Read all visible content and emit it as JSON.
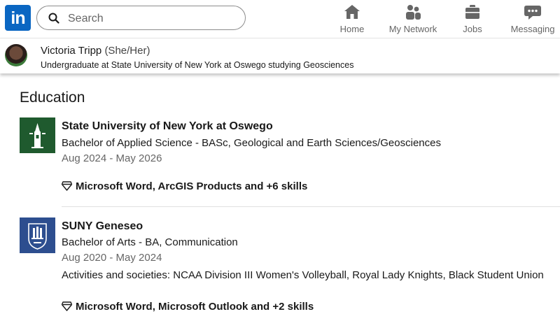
{
  "nav": {
    "logo_text": "in",
    "search": {
      "placeholder": "Search",
      "value": ""
    },
    "items": [
      {
        "label": "Home",
        "icon": "home-icon"
      },
      {
        "label": "My Network",
        "icon": "network-icon"
      },
      {
        "label": "Jobs",
        "icon": "briefcase-icon"
      },
      {
        "label": "Messaging",
        "icon": "messaging-icon"
      }
    ]
  },
  "profile": {
    "name": "Victoria Tripp",
    "pronouns": "(She/Her)",
    "headline": "Undergraduate at State University of New York at Oswego studying Geosciences"
  },
  "education": {
    "title": "Education",
    "entries": [
      {
        "school": "State University of New York at Oswego",
        "degree": "Bachelor of Applied Science - BASc, Geological and Earth Sciences/Geosciences",
        "dates": "Aug 2024 - May 2026",
        "skills": "Microsoft Word, ArcGIS Products and +6 skills",
        "logo_color": "#1f5a2e"
      },
      {
        "school": "SUNY Geneseo",
        "degree": "Bachelor of Arts - BA, Communication",
        "dates": "Aug 2020 - May 2024",
        "activities": "Activities and societies: NCAA Division III Women's Volleyball, Royal Lady Knights, Black Student Union",
        "skills": "Microsoft Word, Microsoft Outlook and +2 skills",
        "logo_color": "#2d4e8f"
      }
    ]
  },
  "colors": {
    "brand": "#0a66c2",
    "text": "#191919",
    "muted": "#666666"
  }
}
